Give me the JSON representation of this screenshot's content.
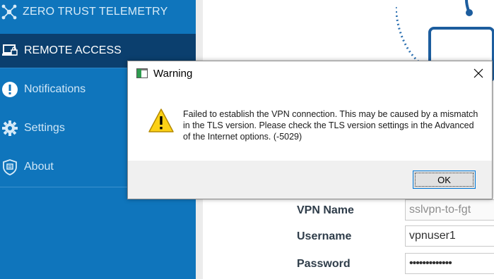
{
  "sidebar": {
    "header_label": "ZERO TRUST TELEMETRY",
    "items": [
      {
        "label": "REMOTE ACCESS",
        "icon": "remote-access-icon"
      },
      {
        "label": "Notifications",
        "icon": "exclamation-icon"
      },
      {
        "label": "Settings",
        "icon": "gear-icon"
      },
      {
        "label": "About",
        "icon": "shield-icon"
      }
    ]
  },
  "form": {
    "vpn_name_label": "VPN Name",
    "vpn_name_value": "sslvpn-to-fgt",
    "username_label": "Username",
    "username_value": "vpnuser1",
    "password_label": "Password",
    "password_value": "•••••••••••••"
  },
  "dialog": {
    "title": "Warning",
    "message": "Failed to establish the VPN connection. This may be caused by a mismatch in the TLS version. Please check the TLS version settings in the Advanced of the Internet options. (-5029)",
    "ok_label": "OK"
  },
  "colors": {
    "sidebar": "#0f75bc",
    "sidebar_active": "#0b3f6e",
    "dialog_footer": "#f0f0f0",
    "accent": "#0078d7"
  }
}
